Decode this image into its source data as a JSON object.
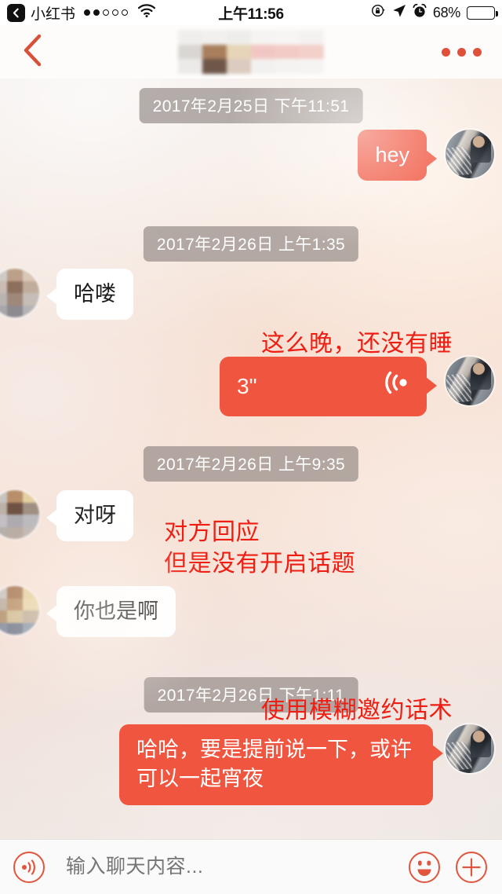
{
  "status_bar": {
    "back_app_label": "小红书",
    "signal_dots_filled": 2,
    "signal_dots_total": 5,
    "wifi_icon": "wifi-icon",
    "time": "上午11:56",
    "rotation_lock_icon": "rotation-lock-icon",
    "location_icon": "location-arrow-icon",
    "alarm_icon": "alarm-clock-icon",
    "battery_percent": "68%",
    "battery_level": 68,
    "battery_color": "#f7ca18"
  },
  "nav_bar": {
    "back_icon": "chevron-left-icon",
    "title": "",
    "title_state": "mosaic-censored",
    "more_icon": "more-dots-icon"
  },
  "theme": {
    "accent": "#f0553f",
    "annotation_red": "#ef1d12",
    "timestamp_bg": "rgba(137,128,124,0.62)",
    "them_bubble": "#ffffff"
  },
  "conversation": [
    {
      "kind": "timestamp",
      "text": "2017年2月25日 下午11:51"
    },
    {
      "kind": "message",
      "side": "me",
      "type": "text",
      "text": "hey"
    },
    {
      "kind": "timestamp",
      "text": "2017年2月26日 上午1:35"
    },
    {
      "kind": "message",
      "side": "them",
      "type": "text",
      "text": "哈喽"
    },
    {
      "kind": "annotation",
      "text": "这么晚，还没有睡"
    },
    {
      "kind": "message",
      "side": "me",
      "type": "voice",
      "duration": "3\"",
      "icon": "sound-wave-icon"
    },
    {
      "kind": "timestamp",
      "text": "2017年2月26日 上午9:35"
    },
    {
      "kind": "message",
      "side": "them",
      "type": "text",
      "text": "对呀"
    },
    {
      "kind": "annotation",
      "text": "对方回应\n但是没有开启话题"
    },
    {
      "kind": "message",
      "side": "them",
      "type": "text",
      "text": "你也是啊"
    },
    {
      "kind": "timestamp",
      "text": "2017年2月26日 下午1:11"
    },
    {
      "kind": "annotation",
      "text": "使用模糊邀约话术"
    },
    {
      "kind": "message",
      "side": "me",
      "type": "text",
      "text": "哈哈，要是提前说一下，或许可以一起宵夜"
    }
  ],
  "messages": {
    "m1_hey": "hey",
    "m2_halou": "哈喽",
    "m3_voice_duration": "3\"",
    "m4_duiya": "对呀",
    "m5_nyesia": "你也是啊",
    "m6_final": "哈哈，要是提前说一下，或许可以一起宵夜"
  },
  "timestamps": {
    "t1": "2017年2月25日 下午11:51",
    "t2": "2017年2月26日 上午1:35",
    "t3": "2017年2月26日 上午9:35",
    "t4": "2017年2月26日 下午1:11"
  },
  "annotations": {
    "a1": "这么晚，还没有睡",
    "a2_line1": "对方回应",
    "a2_line2": "但是没有开启话题",
    "a3": "使用模糊邀约话术"
  },
  "input_bar": {
    "voice_icon": "voice-record-icon",
    "placeholder": "输入聊天内容...",
    "value": "",
    "emoji_icon": "smiley-face-icon",
    "plus_icon": "plus-circle-icon"
  }
}
